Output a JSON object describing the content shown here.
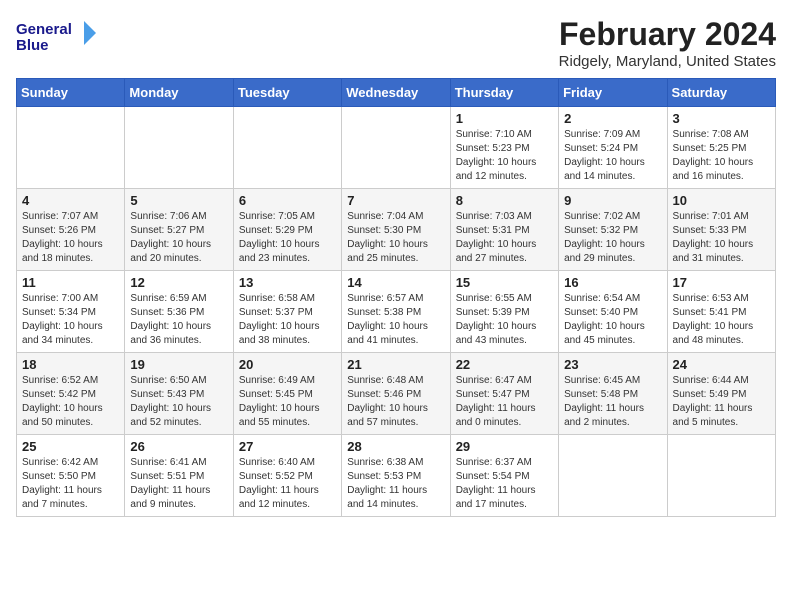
{
  "logo": {
    "line1": "General",
    "line2": "Blue"
  },
  "title": "February 2024",
  "subtitle": "Ridgely, Maryland, United States",
  "days_of_week": [
    "Sunday",
    "Monday",
    "Tuesday",
    "Wednesday",
    "Thursday",
    "Friday",
    "Saturday"
  ],
  "weeks": [
    [
      {
        "day": "",
        "info": ""
      },
      {
        "day": "",
        "info": ""
      },
      {
        "day": "",
        "info": ""
      },
      {
        "day": "",
        "info": ""
      },
      {
        "day": "1",
        "info": "Sunrise: 7:10 AM\nSunset: 5:23 PM\nDaylight: 10 hours\nand 12 minutes."
      },
      {
        "day": "2",
        "info": "Sunrise: 7:09 AM\nSunset: 5:24 PM\nDaylight: 10 hours\nand 14 minutes."
      },
      {
        "day": "3",
        "info": "Sunrise: 7:08 AM\nSunset: 5:25 PM\nDaylight: 10 hours\nand 16 minutes."
      }
    ],
    [
      {
        "day": "4",
        "info": "Sunrise: 7:07 AM\nSunset: 5:26 PM\nDaylight: 10 hours\nand 18 minutes."
      },
      {
        "day": "5",
        "info": "Sunrise: 7:06 AM\nSunset: 5:27 PM\nDaylight: 10 hours\nand 20 minutes."
      },
      {
        "day": "6",
        "info": "Sunrise: 7:05 AM\nSunset: 5:29 PM\nDaylight: 10 hours\nand 23 minutes."
      },
      {
        "day": "7",
        "info": "Sunrise: 7:04 AM\nSunset: 5:30 PM\nDaylight: 10 hours\nand 25 minutes."
      },
      {
        "day": "8",
        "info": "Sunrise: 7:03 AM\nSunset: 5:31 PM\nDaylight: 10 hours\nand 27 minutes."
      },
      {
        "day": "9",
        "info": "Sunrise: 7:02 AM\nSunset: 5:32 PM\nDaylight: 10 hours\nand 29 minutes."
      },
      {
        "day": "10",
        "info": "Sunrise: 7:01 AM\nSunset: 5:33 PM\nDaylight: 10 hours\nand 31 minutes."
      }
    ],
    [
      {
        "day": "11",
        "info": "Sunrise: 7:00 AM\nSunset: 5:34 PM\nDaylight: 10 hours\nand 34 minutes."
      },
      {
        "day": "12",
        "info": "Sunrise: 6:59 AM\nSunset: 5:36 PM\nDaylight: 10 hours\nand 36 minutes."
      },
      {
        "day": "13",
        "info": "Sunrise: 6:58 AM\nSunset: 5:37 PM\nDaylight: 10 hours\nand 38 minutes."
      },
      {
        "day": "14",
        "info": "Sunrise: 6:57 AM\nSunset: 5:38 PM\nDaylight: 10 hours\nand 41 minutes."
      },
      {
        "day": "15",
        "info": "Sunrise: 6:55 AM\nSunset: 5:39 PM\nDaylight: 10 hours\nand 43 minutes."
      },
      {
        "day": "16",
        "info": "Sunrise: 6:54 AM\nSunset: 5:40 PM\nDaylight: 10 hours\nand 45 minutes."
      },
      {
        "day": "17",
        "info": "Sunrise: 6:53 AM\nSunset: 5:41 PM\nDaylight: 10 hours\nand 48 minutes."
      }
    ],
    [
      {
        "day": "18",
        "info": "Sunrise: 6:52 AM\nSunset: 5:42 PM\nDaylight: 10 hours\nand 50 minutes."
      },
      {
        "day": "19",
        "info": "Sunrise: 6:50 AM\nSunset: 5:43 PM\nDaylight: 10 hours\nand 52 minutes."
      },
      {
        "day": "20",
        "info": "Sunrise: 6:49 AM\nSunset: 5:45 PM\nDaylight: 10 hours\nand 55 minutes."
      },
      {
        "day": "21",
        "info": "Sunrise: 6:48 AM\nSunset: 5:46 PM\nDaylight: 10 hours\nand 57 minutes."
      },
      {
        "day": "22",
        "info": "Sunrise: 6:47 AM\nSunset: 5:47 PM\nDaylight: 11 hours\nand 0 minutes."
      },
      {
        "day": "23",
        "info": "Sunrise: 6:45 AM\nSunset: 5:48 PM\nDaylight: 11 hours\nand 2 minutes."
      },
      {
        "day": "24",
        "info": "Sunrise: 6:44 AM\nSunset: 5:49 PM\nDaylight: 11 hours\nand 5 minutes."
      }
    ],
    [
      {
        "day": "25",
        "info": "Sunrise: 6:42 AM\nSunset: 5:50 PM\nDaylight: 11 hours\nand 7 minutes."
      },
      {
        "day": "26",
        "info": "Sunrise: 6:41 AM\nSunset: 5:51 PM\nDaylight: 11 hours\nand 9 minutes."
      },
      {
        "day": "27",
        "info": "Sunrise: 6:40 AM\nSunset: 5:52 PM\nDaylight: 11 hours\nand 12 minutes."
      },
      {
        "day": "28",
        "info": "Sunrise: 6:38 AM\nSunset: 5:53 PM\nDaylight: 11 hours\nand 14 minutes."
      },
      {
        "day": "29",
        "info": "Sunrise: 6:37 AM\nSunset: 5:54 PM\nDaylight: 11 hours\nand 17 minutes."
      },
      {
        "day": "",
        "info": ""
      },
      {
        "day": "",
        "info": ""
      }
    ]
  ]
}
